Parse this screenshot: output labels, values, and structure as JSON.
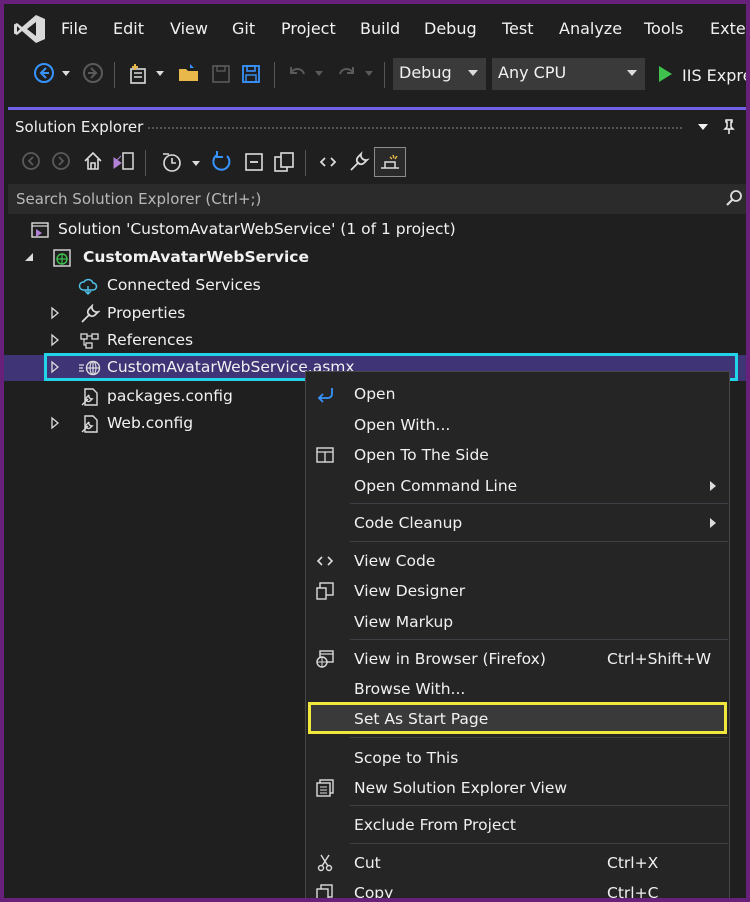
{
  "menubar": {
    "items": [
      "File",
      "Edit",
      "View",
      "Git",
      "Project",
      "Build",
      "Debug",
      "Test",
      "Analyze",
      "Tools",
      "Exter"
    ]
  },
  "toolbar": {
    "config_value": "Debug",
    "platform_value": "Any CPU",
    "run_label": "IIS Expre",
    "icons": [
      "back-icon",
      "forward-icon",
      "new-project-icon",
      "open-folder-icon",
      "save-icon",
      "save-all-icon",
      "undo-icon",
      "redo-icon",
      "play-icon"
    ]
  },
  "solution_explorer": {
    "title": "Solution Explorer",
    "search_placeholder": "Search Solution Explorer (Ctrl+;)",
    "tree": [
      {
        "label": "Solution 'CustomAvatarWebService' (1 of 1 project)",
        "icon": "solution-icon"
      },
      {
        "label": "CustomAvatarWebService",
        "icon": "web-project-icon",
        "bold": true
      },
      {
        "label": "Connected Services",
        "icon": "connected-services-icon"
      },
      {
        "label": "Properties",
        "icon": "wrench-icon"
      },
      {
        "label": "References",
        "icon": "references-icon"
      },
      {
        "label": "CustomAvatarWebService.asmx",
        "icon": "web-service-icon",
        "selected": true
      },
      {
        "label": "packages.config",
        "icon": "config-file-icon"
      },
      {
        "label": "Web.config",
        "icon": "config-file-icon"
      }
    ]
  },
  "context_menu": {
    "items": [
      {
        "label": "Open",
        "icon": "open-icon",
        "shortcut": ""
      },
      {
        "label": "Open With...",
        "icon": "",
        "shortcut": ""
      },
      {
        "label": "Open To The Side",
        "icon": "open-side-icon",
        "shortcut": ""
      },
      {
        "label": "Open Command Line",
        "icon": "",
        "shortcut": "",
        "submenu": true
      },
      {
        "label": "Code Cleanup",
        "icon": "",
        "shortcut": "",
        "submenu": true
      },
      {
        "label": "View Code",
        "icon": "code-icon",
        "shortcut": ""
      },
      {
        "label": "View Designer",
        "icon": "designer-icon",
        "shortcut": ""
      },
      {
        "label": "View Markup",
        "icon": "",
        "shortcut": ""
      },
      {
        "label": "View in Browser (Firefox)",
        "icon": "browser-icon",
        "shortcut": "Ctrl+Shift+W"
      },
      {
        "label": "Browse With...",
        "icon": "",
        "shortcut": ""
      },
      {
        "label": "Set As Start Page",
        "icon": "",
        "shortcut": "",
        "highlighted": true
      },
      {
        "label": "Scope to This",
        "icon": "",
        "shortcut": ""
      },
      {
        "label": "New Solution Explorer View",
        "icon": "new-view-icon",
        "shortcut": ""
      },
      {
        "label": "Exclude From Project",
        "icon": "",
        "shortcut": ""
      },
      {
        "label": "Cut",
        "icon": "scissors-icon",
        "shortcut": "Ctrl+X"
      },
      {
        "label": "Copy",
        "icon": "copy-icon",
        "shortcut": "Ctrl+C"
      }
    ]
  },
  "colors": {
    "frame_border": "#68217a",
    "background": "#1f1f1f",
    "accent": "#7160e8",
    "selection": "#3e3476",
    "selection_outline": "#22d4e8",
    "highlight_outline": "#f0e63c",
    "run_green": "#3fc24d"
  }
}
